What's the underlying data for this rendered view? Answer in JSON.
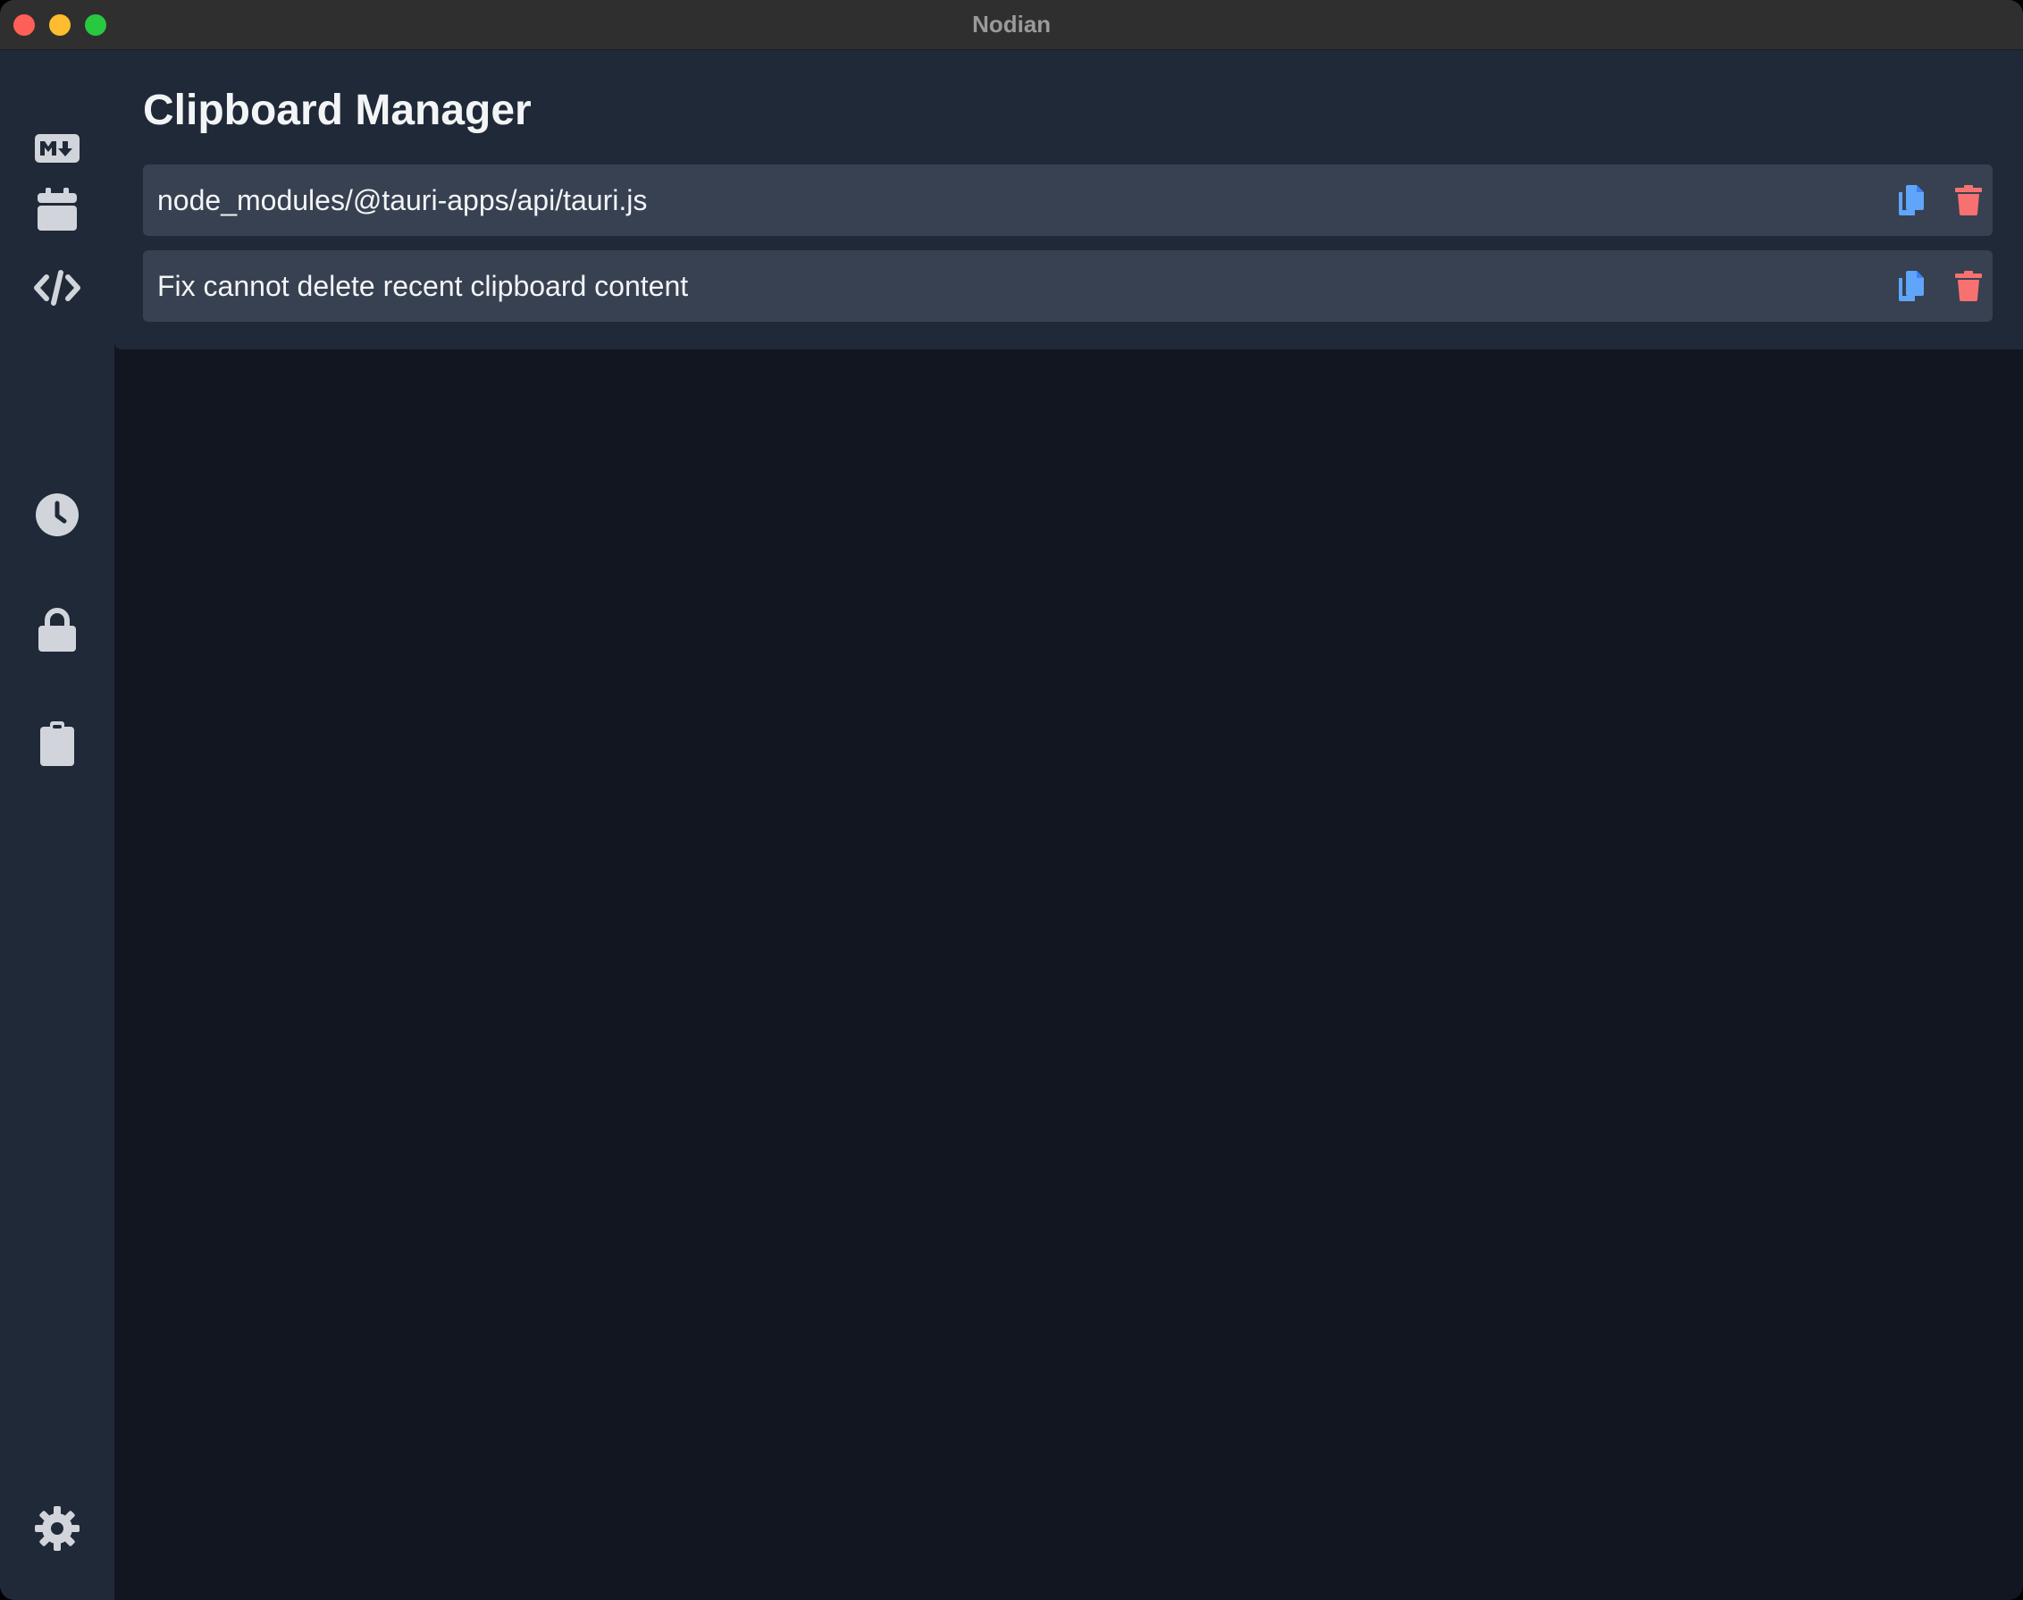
{
  "window": {
    "title": "Nodian"
  },
  "sidebar": {
    "items": [
      {
        "name": "markdown",
        "icon": "markdown-icon"
      },
      {
        "name": "calendar",
        "icon": "calendar-icon"
      },
      {
        "name": "code",
        "icon": "code-icon"
      },
      {
        "name": "history",
        "icon": "clock-icon"
      },
      {
        "name": "passwords",
        "icon": "lock-icon"
      },
      {
        "name": "clipboard",
        "icon": "clipboard-icon"
      }
    ],
    "footer": {
      "name": "settings",
      "icon": "gear-icon"
    }
  },
  "main": {
    "title": "Clipboard Manager",
    "items": [
      {
        "text": "node_modules/@tauri-apps/api/tauri.js"
      },
      {
        "text": "Fix cannot delete recent clipboard content"
      }
    ]
  },
  "colors": {
    "sidebar_bg": "#1f2937",
    "panel_bg": "#1f2937",
    "item_bg": "#374151",
    "app_bg": "#111621",
    "icon": "#d1d5db",
    "copy_icon": "#60a5fa",
    "delete_icon": "#f87171"
  }
}
